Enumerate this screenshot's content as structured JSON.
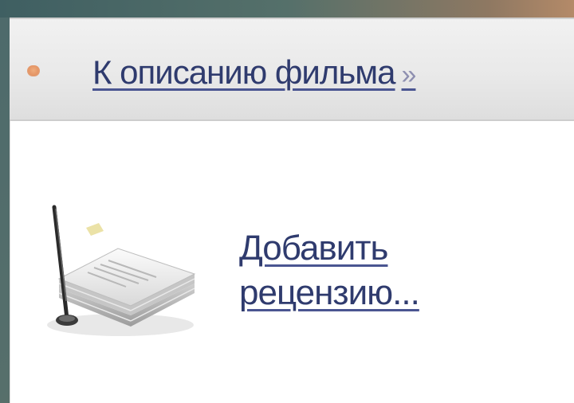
{
  "nav": {
    "back_link_label": "К описанию фильма",
    "back_link_arrows": "»",
    "bullet_icon": "orange-dot-bullet-icon"
  },
  "review": {
    "icon": "document-stack-with-pen-icon",
    "add_link_line1": "Добавить",
    "add_link_line2": "рецензию..."
  },
  "colors": {
    "link": "#2f3b6e",
    "bullet": "#e4874f",
    "nav_background": "#e9e9e9"
  }
}
